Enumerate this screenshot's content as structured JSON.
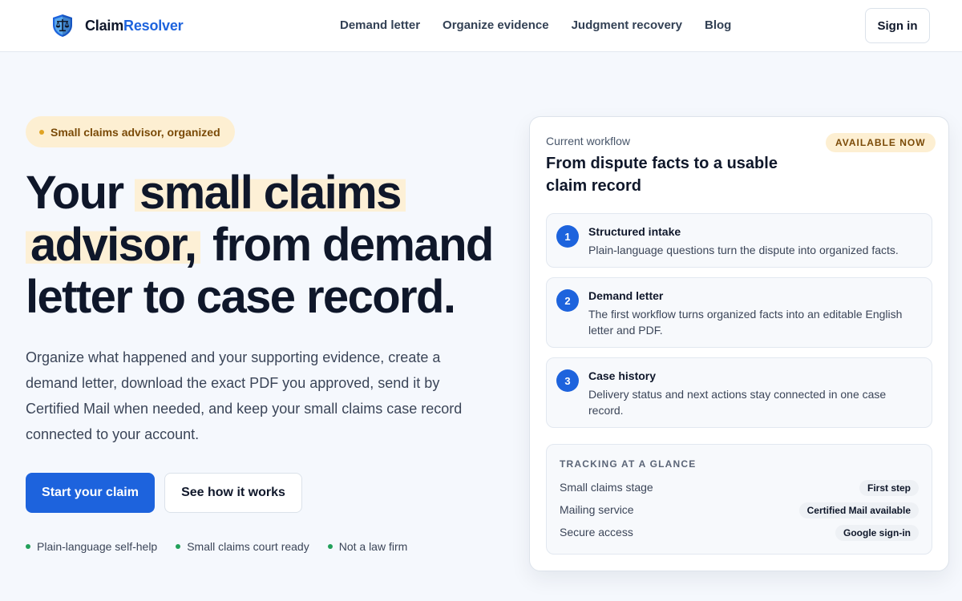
{
  "header": {
    "logo_part1": "Claim",
    "logo_part2": "Resolver",
    "nav": [
      "Demand letter",
      "Organize evidence",
      "Judgment recovery",
      "Blog"
    ],
    "signin_label": "Sign in"
  },
  "hero": {
    "badge": "Small claims advisor, organized",
    "headline": {
      "part1": "Your ",
      "highlight1": "small claims",
      "highlight2": "advisor,",
      "part2": " from demand letter to case record."
    },
    "lede": "Organize what happened and your supporting evidence, create a demand letter, download the exact PDF you approved, send it by Certified Mail when needed, and keep your small claims case record connected to your account.",
    "primary_cta": "Start your claim",
    "secondary_cta": "See how it works",
    "trust_items": [
      "Plain-language self-help",
      "Small claims court ready",
      "Not a law firm"
    ]
  },
  "card": {
    "eyebrow": "Current workflow",
    "title": "From dispute facts to a usable claim record",
    "availability": "AVAILABLE NOW",
    "steps": [
      {
        "num": "1",
        "title": "Structured intake",
        "desc": "Plain-language questions turn the dispute into organized facts."
      },
      {
        "num": "2",
        "title": "Demand letter",
        "desc": "The first workflow turns organized facts into an editable English letter and PDF."
      },
      {
        "num": "3",
        "title": "Case history",
        "desc": "Delivery status and next actions stay connected in one case record."
      }
    ],
    "tracking": {
      "heading": "TRACKING AT A GLANCE",
      "rows": [
        {
          "label": "Small claims stage",
          "value": "First step"
        },
        {
          "label": "Mailing service",
          "value": "Certified Mail available"
        },
        {
          "label": "Secure access",
          "value": "Google sign-in"
        }
      ]
    }
  },
  "colors": {
    "primary": "#1d63dd",
    "highlight": "#fdf0d6",
    "badge_bg": "#fdefd2",
    "badge_text": "#7a4a07",
    "trust_dot": "#22a05a"
  },
  "icons": {
    "logo": "shield-scales-icon"
  }
}
